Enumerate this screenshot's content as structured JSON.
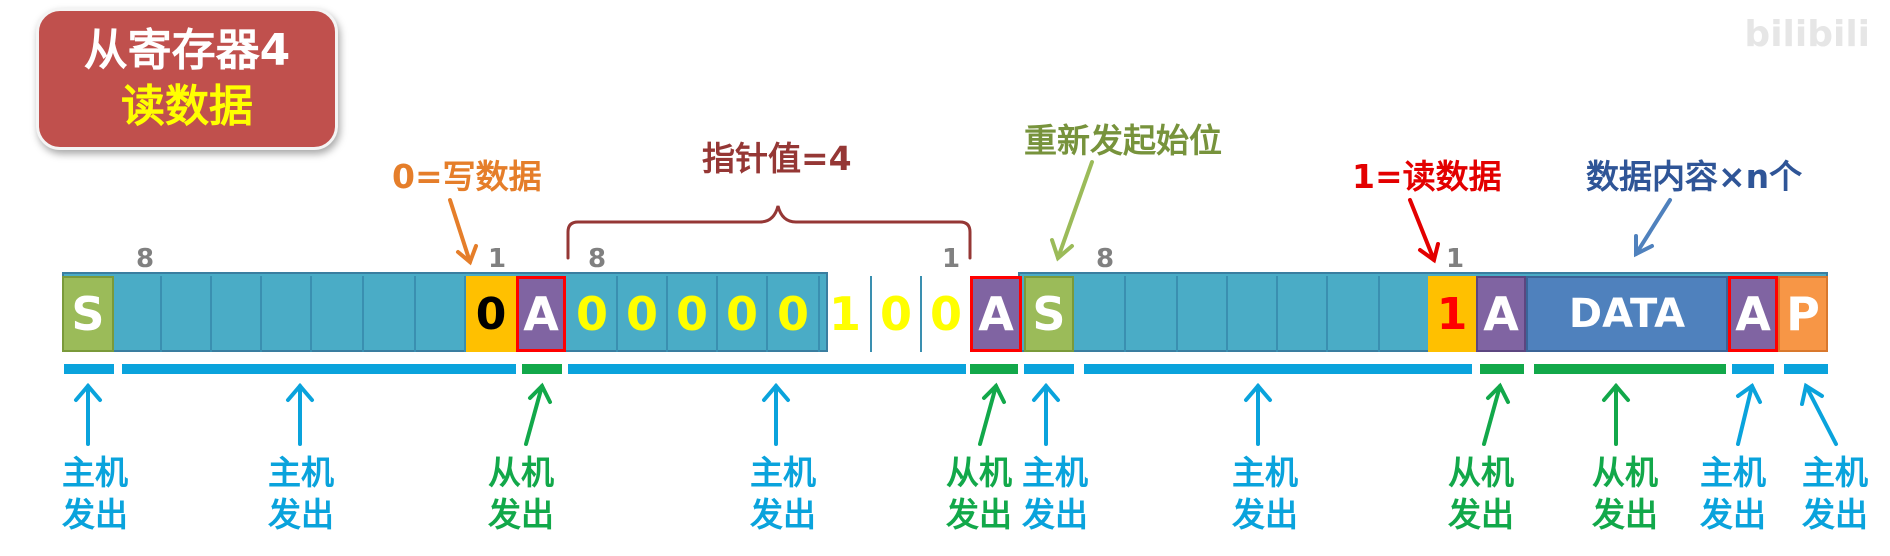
{
  "title": {
    "line1": "从寄存器4",
    "line2": "读数据"
  },
  "watermark": "bilibili",
  "annotations": {
    "write_bit": "0=写数据",
    "pointer_value": "指针值=4",
    "restart": "重新发起始位",
    "read_bit": "1=读数据",
    "data_content": "数据内容×n个"
  },
  "bit_counts": [
    "8",
    "1",
    "8",
    "1",
    "8",
    "1"
  ],
  "frame": {
    "start1": "S",
    "rw_write": "0",
    "ack1": "A",
    "pointer_bits": [
      "0",
      "0",
      "0",
      "0",
      "0",
      "1",
      "0",
      "0"
    ],
    "ack2": "A",
    "start2": "S",
    "rw_read": "1",
    "ack3": "A",
    "data": "DATA",
    "ack4": "A",
    "stop": "P"
  },
  "source_labels": {
    "host": [
      "主机",
      "发出"
    ],
    "slave": [
      "从机",
      "发出"
    ]
  },
  "colors": {
    "start": "#9bbb59",
    "address": "#4aacc6",
    "rw": "#ffc000",
    "ack": "#8064a2",
    "ack_border": "#ff0000",
    "data": "#4f81bd",
    "stop": "#f79646",
    "host": "#0aa3dc",
    "slave": "#12a84a",
    "write_label": "#e57e2a",
    "pointer_label": "#953735",
    "restart_label": "#77933c",
    "read_label": "#e30000",
    "data_label": "#2f5597"
  }
}
